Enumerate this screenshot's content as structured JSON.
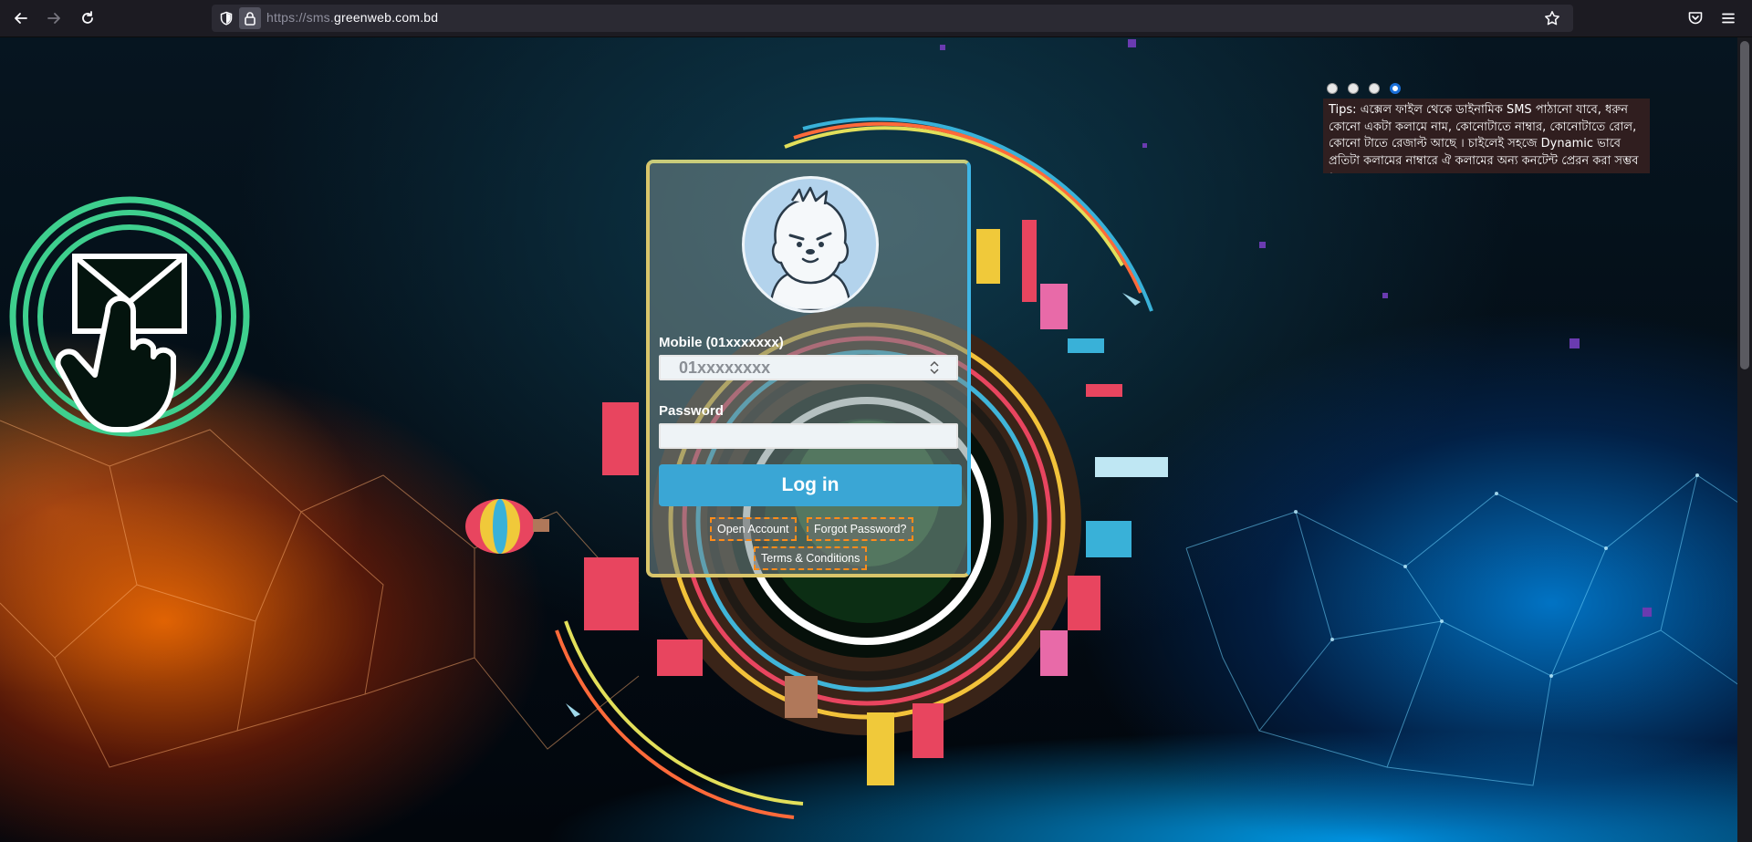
{
  "browser": {
    "url_prefix": "https://sms.",
    "url_host": "greenweb.com.bd",
    "url_suffix": ""
  },
  "tips": {
    "slide_count": 4,
    "active_index": 3,
    "text": "Tips: এক্সেল ফাইল থেকে ডাইনামিক SMS পাঠানো যাবে, ধরুন কোনো একটা কলামে নাম, কোনোটাতে নাম্বার, কোনোটাতে রোল, কোনো টাতে রেজাল্ট আছে । চাইলেই সহজে Dynamic ভাবে প্রতিটা কলামের নাম্বারে ঐ কলামের অন্য কনটেন্ট প্রেরন করা সম্ভব ।"
  },
  "login": {
    "mobile_label": "Mobile (01xxxxxxx)",
    "mobile_placeholder": "01xxxxxxxx",
    "password_label": "Password",
    "password_value": "",
    "login_button": "Log in",
    "open_account": "Open Account",
    "forgot_password": "Forgot Password?",
    "terms": "Terms & Conditions"
  },
  "colors": {
    "login_button": "#3aa6d5",
    "link_border": "#ff8c1a",
    "tips_background": "#342020",
    "accent_green": "#3ecf8e"
  },
  "icons": [
    "back-icon",
    "forward-icon",
    "reload-icon",
    "shield-icon",
    "lock-icon",
    "bookmark-star-icon",
    "pocket-icon",
    "menu-icon",
    "email-touch-icon",
    "yeti-avatar-icon"
  ]
}
